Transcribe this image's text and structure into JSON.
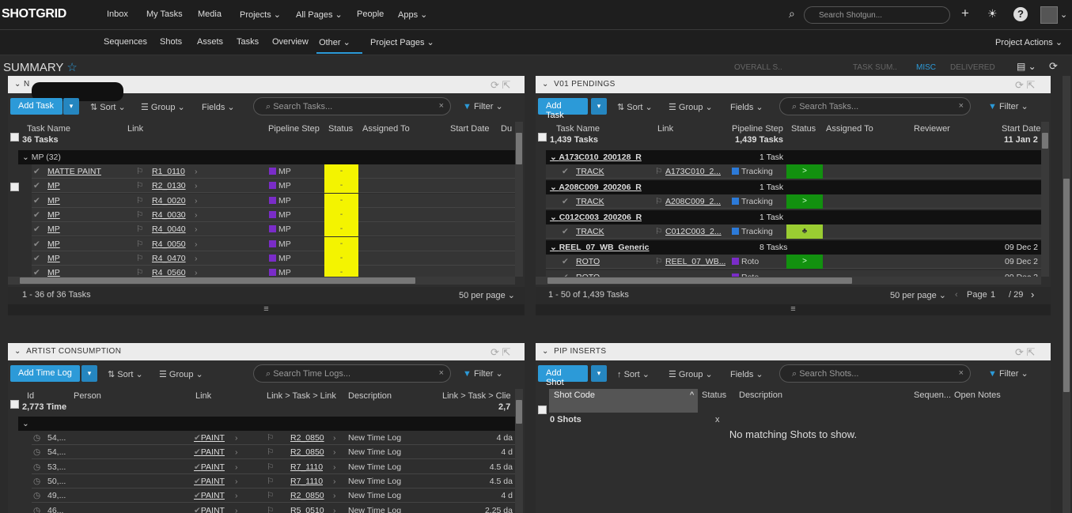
{
  "top": {
    "logo": "SHOTGRID",
    "items": [
      "Inbox",
      "My Tasks",
      "Media",
      "Projects",
      "All Pages",
      "People",
      "Apps"
    ],
    "search_placeholder": "Search Shotgun..."
  },
  "sub": {
    "items": [
      "Sequences",
      "Shots",
      "Assets",
      "Tasks",
      "Overview",
      "Other",
      "Project Pages"
    ],
    "actions": "Project Actions"
  },
  "page": {
    "title": "SUMMARY",
    "tabs": [
      "OVERALL S..",
      "TASK SUM..",
      "MISC",
      "DELIVERED"
    ]
  },
  "p1": {
    "title": "N",
    "add": "Add Task",
    "sort": "Sort",
    "group": "Group",
    "fields": "Fields",
    "search": "Search Tasks...",
    "filter": "Filter",
    "cols": [
      "Task Name",
      "Link",
      "Pipeline Step",
      "Status",
      "Assigned To",
      "Start Date",
      "Du"
    ],
    "count": "36 Tasks",
    "group_label": "MP (32)",
    "rows": [
      [
        "MATTE PAINT",
        "R1_0110",
        "MP",
        "-"
      ],
      [
        "MP",
        "R2_0130",
        "MP",
        "-"
      ],
      [
        "MP",
        "R4_0020",
        "MP",
        "-"
      ],
      [
        "MP",
        "R4_0030",
        "MP",
        "-"
      ],
      [
        "MP",
        "R4_0040",
        "MP",
        "-"
      ],
      [
        "MP",
        "R4_0050",
        "MP",
        "-"
      ],
      [
        "MP",
        "R4_0470",
        "MP",
        "-"
      ],
      [
        "MP",
        "R4_0560",
        "MP",
        "-"
      ]
    ],
    "paging": "1 - 36 of 36 Tasks",
    "per_page": "50 per page"
  },
  "p2": {
    "title": "V01 PENDINGS",
    "add": "Add Task",
    "sort": "Sort",
    "group": "Group",
    "fields": "Fields",
    "search": "Search Tasks...",
    "filter": "Filter",
    "cols": [
      "Task Name",
      "Link",
      "Pipeline Step",
      "Status",
      "Assigned To",
      "Reviewer",
      "Start Date"
    ],
    "count": "1,439 Tasks",
    "count2": "1,439 Tasks",
    "date_top": "11 Jan 2",
    "groups": [
      {
        "name": "A173C010_200128_R",
        "n": "1 Task",
        "task": "TRACK",
        "link": "A173C010_2...",
        "step": "Tracking",
        "status": ">",
        "date": ""
      },
      {
        "name": "A208C009_200206_R",
        "n": "1 Task",
        "task": "TRACK",
        "link": "A208C009_2...",
        "step": "Tracking",
        "status": ">",
        "date": ""
      },
      {
        "name": "C012C003_200206_R",
        "n": "1 Task",
        "task": "TRACK",
        "link": "C012C003_2...",
        "step": "Tracking",
        "status": "♣",
        "date": ""
      },
      {
        "name": "REEL_07_WB_Generic",
        "n": "8 Tasks",
        "task": "ROTO",
        "link": "REEL_07_WB...",
        "step": "Roto",
        "status": ">",
        "date": "09 Dec 2"
      }
    ],
    "group_date": "09 Dec 2",
    "extra_task": "ROTO",
    "extra_step": "Roto",
    "extra_date": "09 Dec 2",
    "paging": "1 - 50 of 1,439 Tasks",
    "per_page": "50 per page",
    "page_label": "Page",
    "page_val": "1",
    "page_total": "/ 29"
  },
  "p3": {
    "title": "ARTIST CONSUMPTION",
    "add": "Add Time Log",
    "sort": "Sort",
    "group": "Group",
    "search": "Search Time Logs...",
    "filter": "Filter",
    "cols": [
      "Id",
      "Person",
      "Link",
      "Link > Task > Link",
      "Description",
      "Link > Task > Clie"
    ],
    "count": "2,773 Time",
    "count_right": "2,7",
    "rows": [
      [
        "54,...",
        "PAINT",
        "R2_0850",
        "New Time Log",
        "4 da"
      ],
      [
        "54,...",
        "PAINT",
        "R2_0850",
        "New Time Log",
        "4 d"
      ],
      [
        "53,...",
        "PAINT",
        "R7_1110",
        "New Time Log",
        "4.5 da"
      ],
      [
        "50,...",
        "PAINT",
        "R7_1110",
        "New Time Log",
        "4.5 da"
      ],
      [
        "49,...",
        "PAINT",
        "R2_0850",
        "New Time Log",
        "4 d"
      ],
      [
        "46...",
        "PAINT",
        "R5_0510",
        "New Time Log",
        "2.25 da"
      ]
    ]
  },
  "p4": {
    "title": "PIP INSERTS",
    "add": "Add Shot",
    "sort": "Sort",
    "group": "Group",
    "fields": "Fields",
    "search": "Search Shots...",
    "filter": "Filter",
    "cols": [
      "Shot Code",
      "Status",
      "Description",
      "Sequen...",
      "Open Notes"
    ],
    "count": "0 Shots",
    "x": "x",
    "empty": "No matching Shots to show."
  },
  "colors": {
    "accent": "#2c9ad8",
    "yellow": "#f4f400",
    "green": "#12910f",
    "purple": "#7a2cc8",
    "blue": "#2c7ad8"
  }
}
